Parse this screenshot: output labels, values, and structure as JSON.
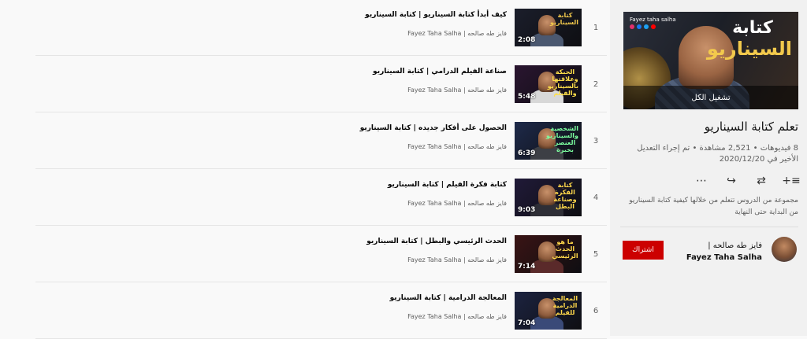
{
  "playlist": {
    "thumb_title": "كتابة",
    "thumb_subtitle": "السيناريو",
    "thumb_brand": "Fayez taha salha",
    "play_all_label": "تشغيل الكل",
    "title": "تعلم كتابة السيناريو",
    "meta": "8 فيديوهات • 2,521 مشاهدة • تم إجراء التعديل الأخير في 2020/12/20",
    "description": "مجموعة من الدروس تتعلم من خلالها كيفية كتابة السيناريو من البداية حتى النهاية",
    "owner_name": "Fayez Taha Salha",
    "owner_name_ar": "فايز طه صالحه |",
    "subscribe_label": "اشتراك",
    "icons": [
      "add-to-queue-icon",
      "shuffle-icon",
      "share-icon",
      "more-icon"
    ],
    "icon_glyphs": [
      "≡+",
      "⇄",
      "↪",
      "⋯"
    ]
  },
  "videos": [
    {
      "index": "1",
      "title": "كيف أبدأ كتابة السيناريو | كتابة السيناريو",
      "channel": "فايز طه صالحه | Fayez Taha Salha",
      "duration": "2:08",
      "caption": "كتابة السيناريو",
      "bg": "#1b1e2b",
      "caption_color": "#f2c94c",
      "torso": "#4b5870"
    },
    {
      "index": "2",
      "title": "صناعة الفيلم الدرامي | كتابة السيناريو",
      "channel": "فايز طه صالحه | Fayez Taha Salha",
      "duration": "5:48",
      "caption": "الحبكة وعلاقتها بالسيناريو والفيلم",
      "bg": "#2a1530",
      "caption_color": "#ffe04a",
      "torso": "#d8d8d8"
    },
    {
      "index": "3",
      "title": "الحصول على أفكار جديده | كتابة السيناريو",
      "channel": "فايز طه صالحه | Fayez Taha Salha",
      "duration": "6:39",
      "caption": "الشخصية والسيناريو العنصر بخبرة",
      "bg": "#1e2a4a",
      "caption_color": "#7dffa0",
      "torso": "#3d3f45"
    },
    {
      "index": "4",
      "title": "كتابة فكرة الفيلم | كتابة السيناريو",
      "channel": "فايز طه صالحه | Fayez Taha Salha",
      "duration": "9:03",
      "caption": "كتابة الفكرة وصناعة البطل",
      "bg": "#201a38",
      "caption_color": "#ffd84a",
      "torso": "#2e2e36"
    },
    {
      "index": "5",
      "title": "الحدث الرئيسي والبطل | كتابة السيناريو",
      "channel": "فايز طه صالحه | Fayez Taha Salha",
      "duration": "7:14",
      "caption": "ما هو الحدث الرئيسي",
      "bg": "#3a1414",
      "caption_color": "#ffd84a",
      "torso": "#5a2a2a"
    },
    {
      "index": "6",
      "title": "المعالجة الدرامية | كتابة السيناريو",
      "channel": "فايز طه صالحه | Fayez Taha Salha",
      "duration": "7:04",
      "caption": "المعالجة الدرامية للفيلم",
      "bg": "#1c2340",
      "caption_color": "#ffd84a",
      "torso": "#3a4a78"
    }
  ]
}
